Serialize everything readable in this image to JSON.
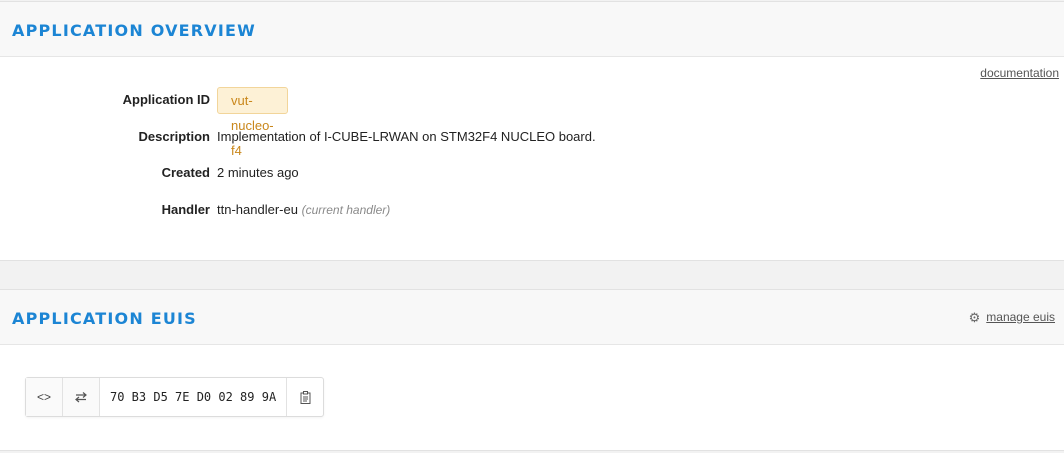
{
  "overview": {
    "title": "APPLICATION OVERVIEW",
    "documentation_link": "documentation",
    "fields": {
      "app_id_label": "Application ID",
      "app_id_value": "vut-nucleo-f4",
      "description_label": "Description",
      "description_value": "Implementation of I-CUBE-LRWAN on STM32F4 NUCLEO board.",
      "created_label": "Created",
      "created_value": "2 minutes ago",
      "handler_label": "Handler",
      "handler_value": "ttn-handler-eu",
      "handler_note": "(current handler)"
    }
  },
  "euis": {
    "title": "APPLICATION EUIS",
    "manage_link": "manage euis",
    "items": [
      {
        "value": "70 B3 D5 7E D0 02 89 9A"
      }
    ],
    "icons": {
      "toggle_format": "code-brackets-icon",
      "swap_order": "swap-arrows-icon",
      "copy": "clipboard-icon",
      "manage": "gear-icon"
    }
  },
  "colors": {
    "accent": "#1c85d4",
    "badge_bg": "#fdf1d6",
    "badge_text": "#c9871b"
  }
}
